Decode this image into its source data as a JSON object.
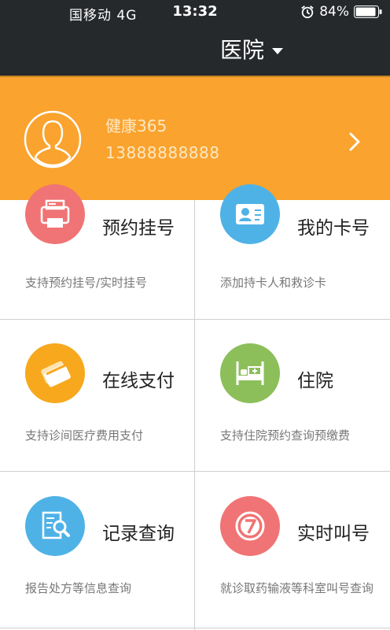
{
  "status_bar": {
    "carrier": "国移动 4G",
    "time": "13:32",
    "battery": "84%"
  },
  "nav": {
    "title": "医院"
  },
  "profile": {
    "name": "健康365",
    "phone": "13888888888"
  },
  "colors": {
    "header_bg": "#26292c",
    "accent_orange": "#faa32e",
    "red": "#f07475",
    "blue": "#4fb2e6",
    "orange": "#f7a81c",
    "green": "#8cbf5a"
  },
  "services": [
    {
      "title": "预约挂号",
      "desc": "支持预约挂号/实时挂号",
      "icon": "registration-icon",
      "color": "#f07475"
    },
    {
      "title": "我的卡号",
      "desc": "添加持卡人和救诊卡",
      "icon": "id-card-icon",
      "color": "#4fb2e6"
    },
    {
      "title": "在线支付",
      "desc": "支持诊间医疗费用支付",
      "icon": "payment-card-icon",
      "color": "#f7a81c"
    },
    {
      "title": "住院",
      "desc": "支持住院预约查询预缴费",
      "icon": "hospital-bed-icon",
      "color": "#8cbf5a"
    },
    {
      "title": "记录查询",
      "desc": "报告处方等信息查询",
      "icon": "document-search-icon",
      "color": "#4fb2e6"
    },
    {
      "title": "实时叫号",
      "desc": "就诊取药输液等科室叫号查询",
      "icon": "queue-number-icon",
      "color": "#f07475"
    }
  ]
}
